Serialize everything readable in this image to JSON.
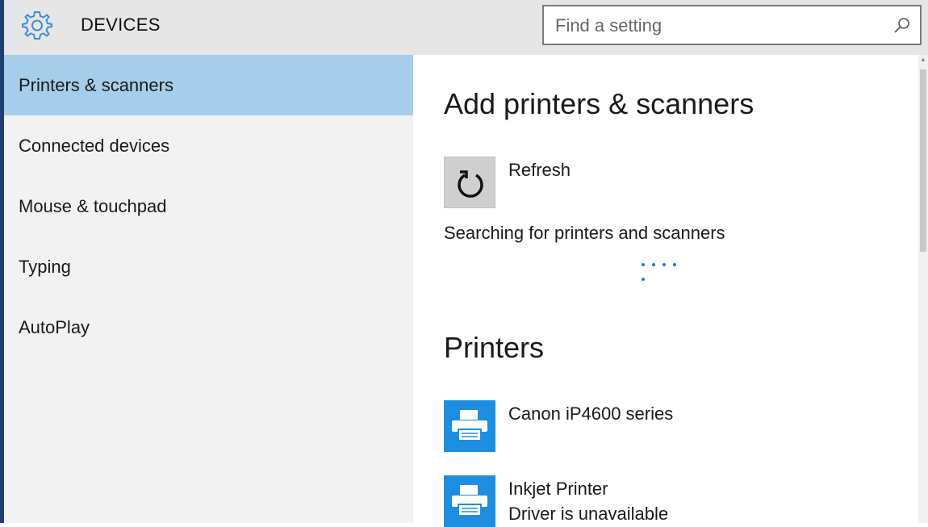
{
  "header": {
    "title": "DEVICES",
    "icon": "gear-icon",
    "accent": "#3a8fd6",
    "search": {
      "placeholder": "Find a setting",
      "icon": "search-icon"
    }
  },
  "sidebar": {
    "selected_color": "#a6cdea",
    "items": [
      {
        "label": "Printers & scanners",
        "selected": true
      },
      {
        "label": "Connected devices",
        "selected": false
      },
      {
        "label": "Mouse & touchpad",
        "selected": false
      },
      {
        "label": "Typing",
        "selected": false
      },
      {
        "label": "AutoPlay",
        "selected": false
      }
    ]
  },
  "main": {
    "add_section": {
      "title": "Add printers & scanners",
      "refresh_label": "Refresh",
      "refresh_icon": "refresh-icon",
      "status": "Searching for printers and scanners"
    },
    "printers_section": {
      "title": "Printers",
      "tile_color": "#1e8fe0",
      "items": [
        {
          "name": "Canon iP4600 series",
          "status": "",
          "icon": "printer-icon"
        },
        {
          "name": "Inkjet Printer",
          "status": "Driver is unavailable",
          "icon": "printer-icon"
        }
      ]
    }
  }
}
